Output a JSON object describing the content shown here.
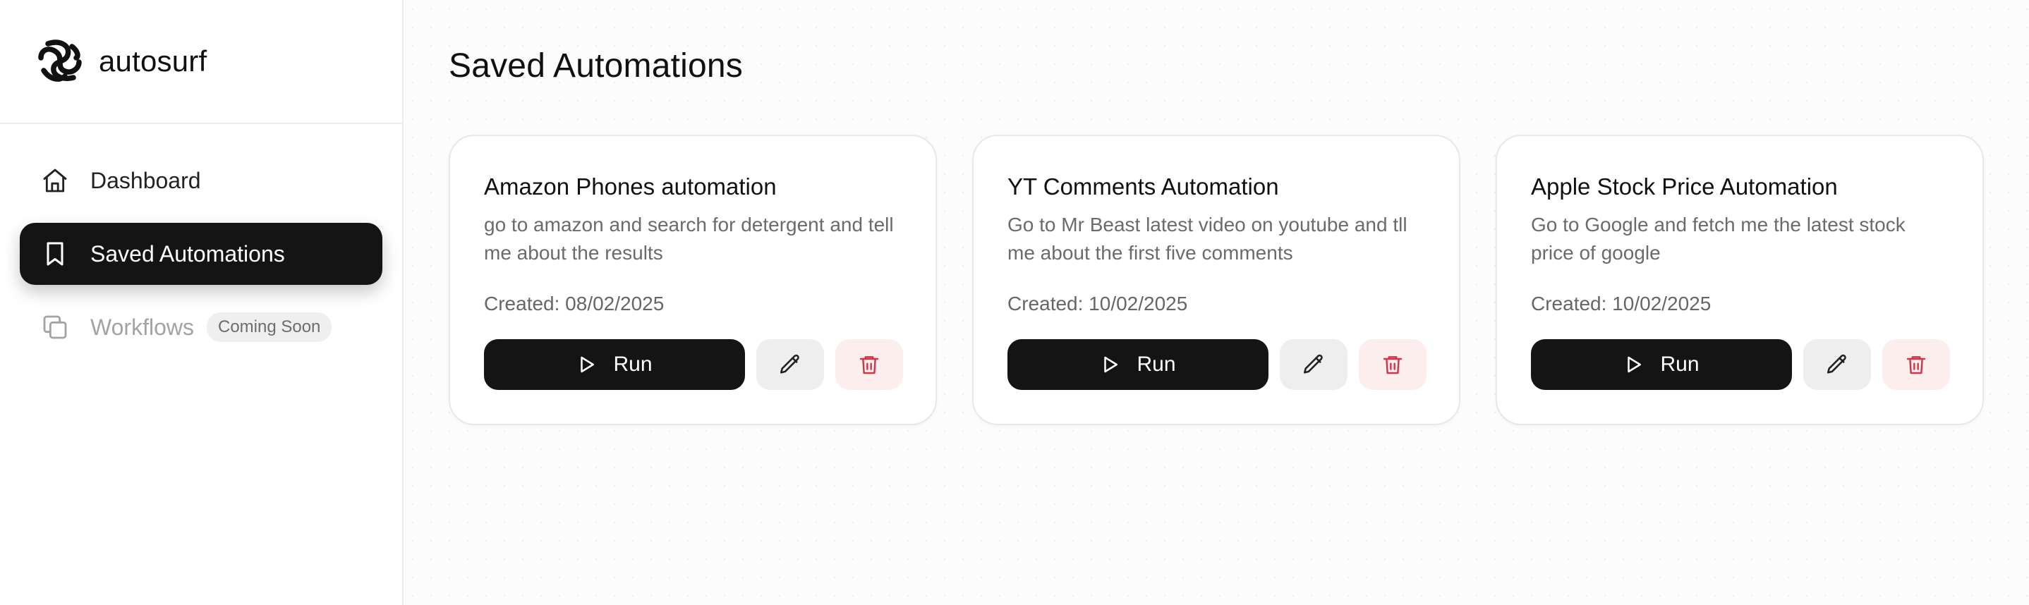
{
  "brand": {
    "name": "autosurf",
    "logo_icon": "autosurf-logo-icon"
  },
  "sidebar": {
    "items": [
      {
        "label": "Dashboard",
        "icon": "home-icon",
        "active": false
      },
      {
        "label": "Saved Automations",
        "icon": "bookmark-icon",
        "active": true
      },
      {
        "label": "Workflows",
        "icon": "copy-icon",
        "active": false,
        "badge": "Coming Soon",
        "disabled": true
      }
    ]
  },
  "main": {
    "title": "Saved Automations",
    "cards": [
      {
        "title": "Amazon Phones automation",
        "description": "go to amazon and search for detergent and tell me about the results",
        "created": "Created: 08/02/2025",
        "run_label": "Run"
      },
      {
        "title": "YT Comments Automation",
        "description": "Go to Mr Beast latest video on youtube and tll me about the first five comments",
        "created": "Created: 10/02/2025",
        "run_label": "Run"
      },
      {
        "title": "Apple Stock Price Automation",
        "description": "Go to Google and fetch me the latest stock price of google",
        "created": "Created: 10/02/2025",
        "run_label": "Run"
      }
    ]
  },
  "colors": {
    "primary": "#141414",
    "delete_accent": "#d3344a",
    "delete_bg": "#fdeeee",
    "edit_bg": "#eeeeee",
    "muted_text": "#6b6b6b",
    "disabled_text": "#a3a3a3"
  }
}
